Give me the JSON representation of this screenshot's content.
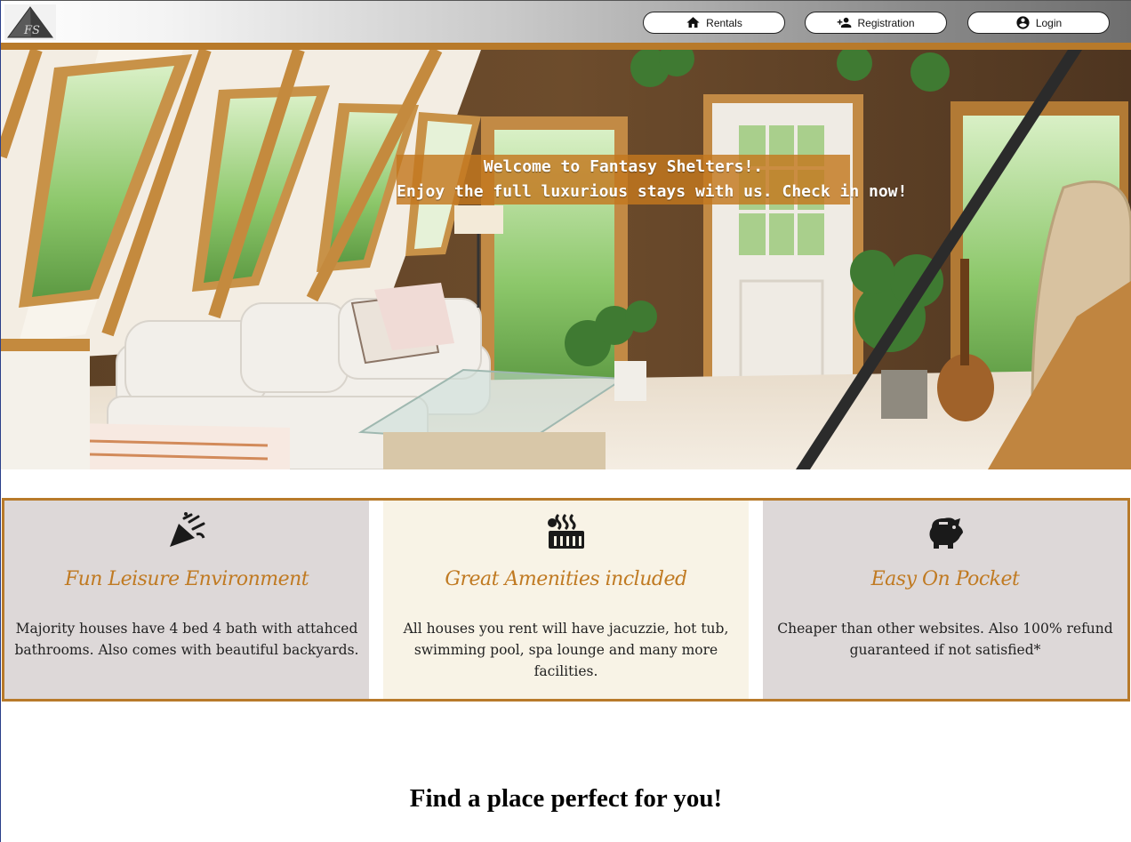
{
  "header": {
    "logo_text": "FS",
    "nav": [
      {
        "label": "Rentals",
        "icon": "home-icon"
      },
      {
        "label": "Registration",
        "icon": "add-user-icon"
      },
      {
        "label": "Login",
        "icon": "account-circle-icon"
      }
    ]
  },
  "hero": {
    "welcome_line1": "Welcome to Fantasy Shelters!.",
    "welcome_line2": "Enjoy the full luxurious stays with us. Check in now!"
  },
  "features": [
    {
      "icon": "party-popper-icon",
      "title": "Fun Leisure Environment",
      "text": "Majority houses have 4 bed 4 bath with attahced bathrooms. Also comes with beautiful backyards."
    },
    {
      "icon": "hot-tub-icon",
      "title": "Great Amenities included",
      "text": "All houses you rent will have jacuzzie, hot tub, swimming pool, spa lounge and many more facilities."
    },
    {
      "icon": "piggy-bank-icon",
      "title": "Easy On Pocket",
      "text": "Cheaper than other websites. Also 100% refund guaranteed if not satisfied*"
    }
  ],
  "find_section": {
    "title": "Find a place perfect for you!"
  },
  "colors": {
    "accent": "#b87a2a",
    "feature_title": "#c07a22",
    "feature_bg_grey": "#ddd8d8",
    "feature_bg_cream": "#f8f3e6"
  }
}
